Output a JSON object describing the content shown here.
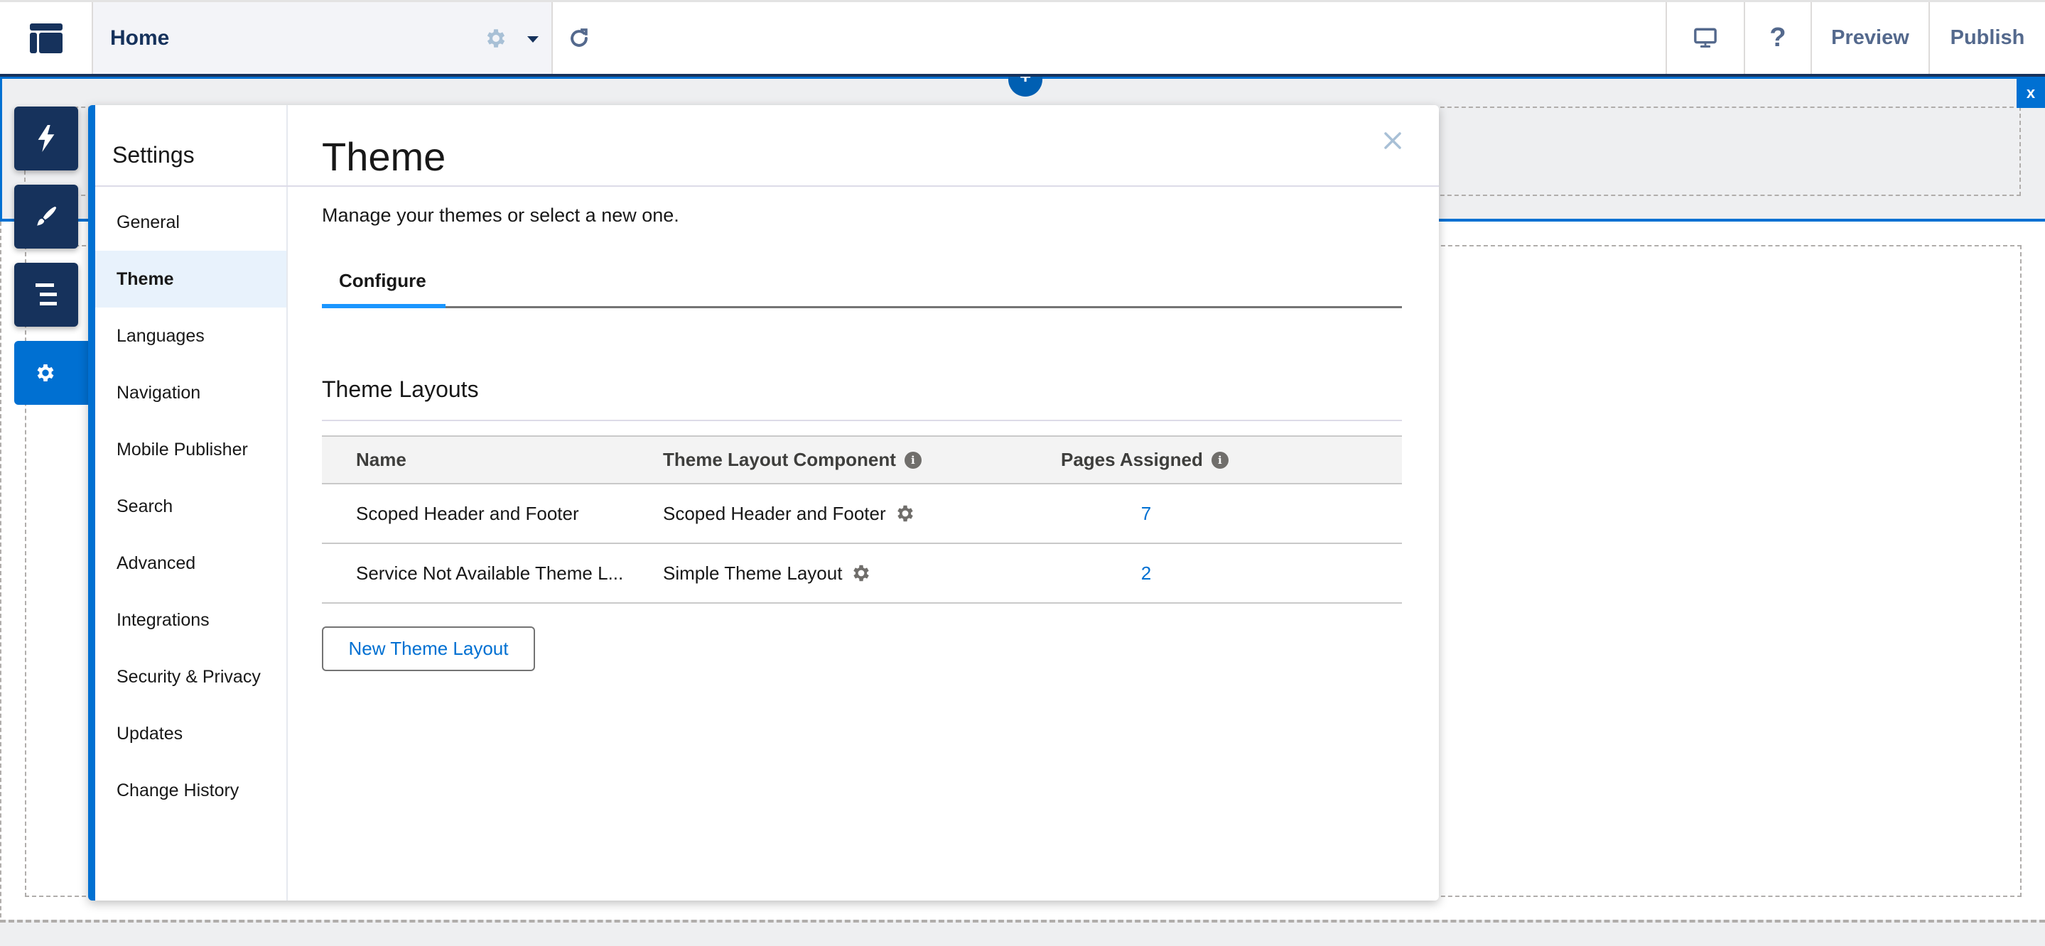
{
  "topbar": {
    "page_title": "Home",
    "preview_label": "Preview",
    "publish_label": "Publish",
    "help_label": "?",
    "icons": {
      "logo": "layout-icon",
      "page_settings": "gear-icon",
      "page_menu": "caret-down-icon",
      "refresh": "refresh-icon",
      "device": "desktop-icon"
    }
  },
  "canvas": {
    "add_section_label": "+",
    "close_region_label": "x"
  },
  "rail": {
    "items": [
      {
        "name": "components",
        "icon": "lightning-icon"
      },
      {
        "name": "theme",
        "icon": "paintbrush-icon"
      },
      {
        "name": "page-structure",
        "icon": "list-icon"
      },
      {
        "name": "settings",
        "icon": "gear-icon",
        "active": true
      }
    ]
  },
  "settings": {
    "title": "Settings",
    "nav": [
      {
        "label": "General"
      },
      {
        "label": "Theme",
        "active": true
      },
      {
        "label": "Languages"
      },
      {
        "label": "Navigation"
      },
      {
        "label": "Mobile Publisher"
      },
      {
        "label": "Search"
      },
      {
        "label": "Advanced"
      },
      {
        "label": "Integrations"
      },
      {
        "label": "Security & Privacy"
      },
      {
        "label": "Updates"
      },
      {
        "label": "Change History"
      }
    ]
  },
  "content": {
    "title": "Theme",
    "subtitle": "Manage your themes or select a new one.",
    "tabs": [
      {
        "label": "Configure",
        "active": true
      }
    ],
    "section_title": "Theme Layouts",
    "table": {
      "headers": [
        "Name",
        "Theme Layout Component",
        "Pages Assigned"
      ],
      "rows": [
        {
          "name": "Scoped Header and Footer",
          "component": "Scoped Header and Footer",
          "pages": "7"
        },
        {
          "name": "Service Not Available Theme L...",
          "component": "Simple Theme Layout",
          "pages": "2"
        }
      ]
    },
    "new_button_label": "New Theme Layout"
  },
  "colors": {
    "brand_navy": "#16325c",
    "accent_blue": "#0070d2",
    "tab_active": "#1b96ff",
    "link_blue": "#0070d2"
  }
}
